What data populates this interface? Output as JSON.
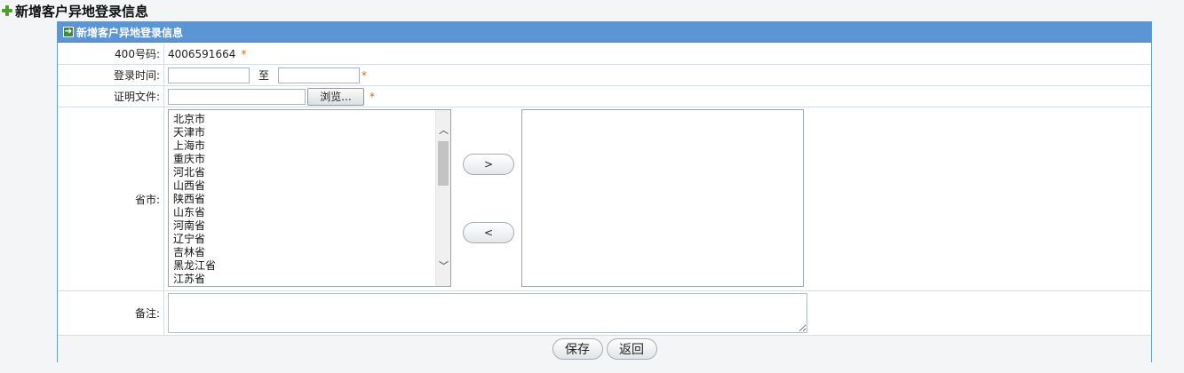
{
  "page_title": "新增客户异地登录信息",
  "panel": {
    "header": "新增客户异地登录信息"
  },
  "form": {
    "phone": {
      "label": "400号码:",
      "value": "4006591664",
      "required_mark": "*"
    },
    "login_time": {
      "label": "登录时间:",
      "from_value": "",
      "to_label": "至",
      "to_value": "",
      "required_mark": "*"
    },
    "proof_file": {
      "label": "证明文件:",
      "value": "",
      "browse_label": "浏览...",
      "required_mark": "*"
    },
    "province": {
      "label": "省市:",
      "available": [
        "北京市",
        "天津市",
        "上海市",
        "重庆市",
        "河北省",
        "山西省",
        "陕西省",
        "山东省",
        "河南省",
        "辽宁省",
        "吉林省",
        "黑龙江省",
        "江苏省"
      ],
      "selected": [],
      "add_label": ">",
      "remove_label": "<"
    },
    "remark": {
      "label": "备注:",
      "value": ""
    }
  },
  "actions": {
    "save_label": "保存",
    "back_label": "返回"
  },
  "colors": {
    "header_bg": "#5b95d6",
    "required": "#e06a00",
    "plus_icon": "#4aa02c"
  }
}
